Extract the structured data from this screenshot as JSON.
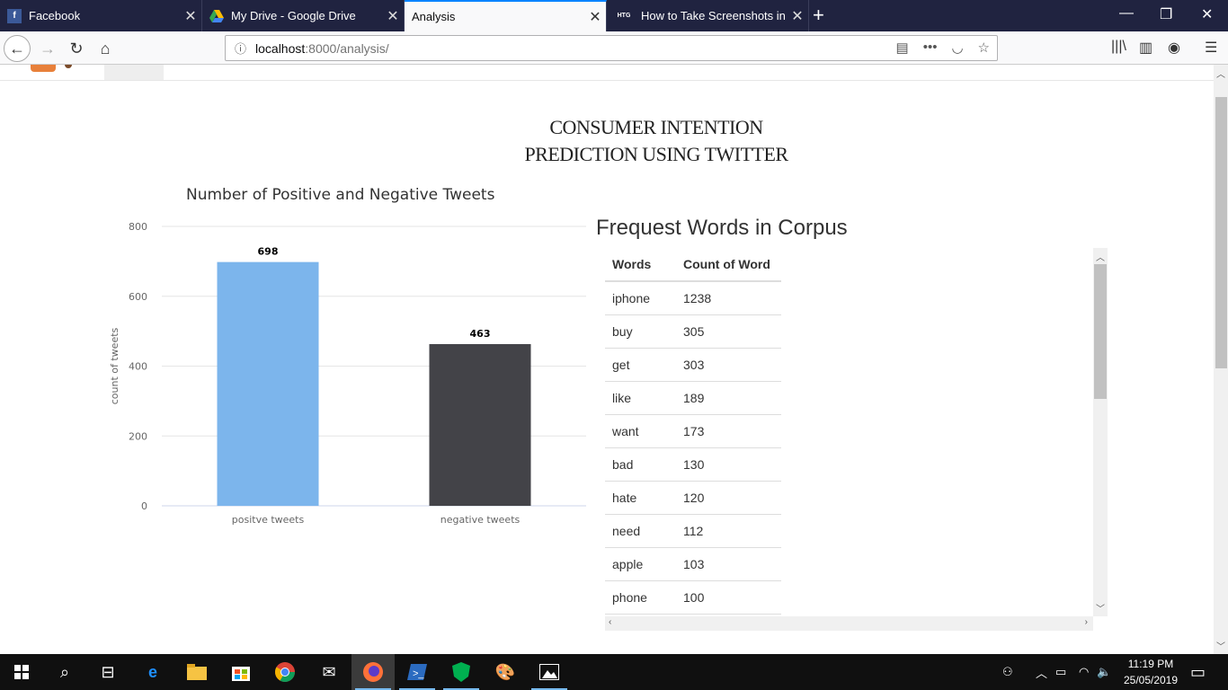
{
  "browser": {
    "tabs": [
      {
        "title": "Facebook",
        "favicon": "facebook-icon"
      },
      {
        "title": "My Drive - Google Drive",
        "favicon": "google-drive-icon"
      },
      {
        "title": "Analysis",
        "favicon": "none",
        "active": true
      },
      {
        "title": "How to Take Screenshots in Wi",
        "favicon": "htg-icon",
        "favicon_text": "HTG"
      }
    ],
    "url": {
      "host": "localhost",
      "path": ":8000/analysis/"
    }
  },
  "page": {
    "title_line1": "CONSUMER INTENTION",
    "title_line2": "PREDICTION USING TWITTER",
    "words_title": "Frequest Words in Corpus"
  },
  "chart_data": {
    "type": "bar",
    "title": "Number of Positive and Negative Tweets",
    "categories": [
      "positve tweets",
      "negative tweets"
    ],
    "values": [
      698,
      463
    ],
    "colors": [
      "#7cb5ec",
      "#434348"
    ],
    "ylabel": "count of tweets",
    "xlabel": "",
    "ylim": [
      0,
      800
    ],
    "yticks": [
      0,
      200,
      400,
      600,
      800
    ],
    "grid": true
  },
  "word_table": {
    "headers": [
      "Words",
      "Count of Word"
    ],
    "rows": [
      [
        "iphone",
        "1238"
      ],
      [
        "buy",
        "305"
      ],
      [
        "get",
        "303"
      ],
      [
        "like",
        "189"
      ],
      [
        "want",
        "173"
      ],
      [
        "bad",
        "130"
      ],
      [
        "hate",
        "120"
      ],
      [
        "need",
        "112"
      ],
      [
        "apple",
        "103"
      ],
      [
        "phone",
        "100"
      ]
    ]
  },
  "taskbar": {
    "time": "11:19 PM",
    "date": "25/05/2019"
  }
}
